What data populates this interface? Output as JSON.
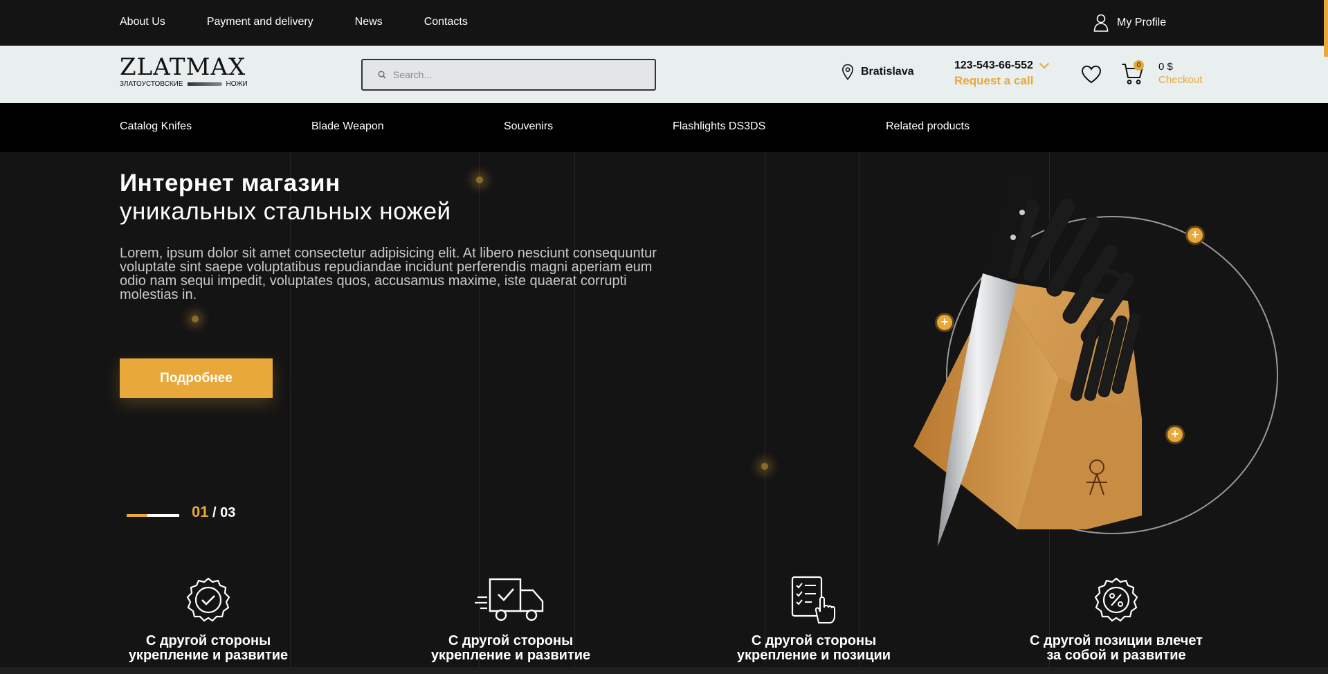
{
  "topbar": {
    "links": [
      "About Us",
      "Payment and delivery",
      "News",
      "Contacts"
    ],
    "profile_label": "My Profile"
  },
  "header": {
    "logo_main": "ZLATMAX",
    "logo_left": "ЗЛАТОУСТОВСКИЕ",
    "logo_right": "НОЖИ",
    "search_placeholder": "Search...",
    "city": "Bratislava",
    "phone": "123-543-66-552",
    "request_call": "Request a call",
    "cart_count": "0",
    "cart_amount": "0 $",
    "checkout": "Checkout"
  },
  "catnav": {
    "items": [
      "Catalog Knifes",
      "Blade Weapon",
      "Souvenirs",
      "Flashlights DS3DS",
      "Related products"
    ]
  },
  "hero": {
    "title": "Интернет магазин",
    "subtitle": "уникальных стальных ножей",
    "text": "Lorem, ipsum dolor sit amet consectetur adipisicing elit. At libero nesciunt consequuntur voluptate sint saepe voluptatibus repudiandae incidunt perferendis magni aperiam eum odio nam sequi impedit, voluptates quos, accusamus maxime, iste quaerat corrupti molestias in.",
    "button": "Подробнее",
    "slide_current": "01",
    "slide_total": "/ 03",
    "slide_progress": 0.4
  },
  "features": [
    {
      "line1": "С другой стороны",
      "line2": "укрепление и развитие",
      "icon": "badge-check-icon"
    },
    {
      "line1": "С другой стороны",
      "line2": "укрепление и развитие",
      "icon": "delivery-truck-icon"
    },
    {
      "line1": "С другой стороны",
      "line2": "укрепление и позиции",
      "icon": "checklist-hand-icon"
    },
    {
      "line1": "С другой позиции влечет",
      "line2": "за собой и развитие",
      "icon": "discount-badge-icon"
    }
  ],
  "colors": {
    "accent": "#e8a93a",
    "background": "#141414",
    "header_bg": "#e9eeee",
    "nav_bg": "#000000"
  }
}
